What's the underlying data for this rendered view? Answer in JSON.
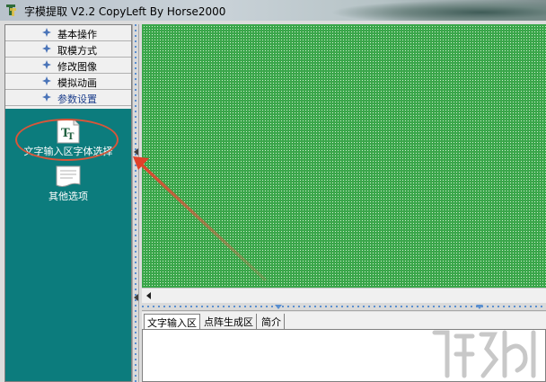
{
  "window": {
    "title": "字模提取 V2.2  CopyLeft By Horse2000",
    "icon": "app-icon"
  },
  "menu": {
    "items": [
      {
        "label": "基本操作",
        "icon": "diamond-icon"
      },
      {
        "label": "取模方式",
        "icon": "diamond-icon"
      },
      {
        "label": "修改图像",
        "icon": "diamond-icon"
      },
      {
        "label": "模拟动画",
        "icon": "diamond-icon"
      },
      {
        "label": "参数设置",
        "icon": "diamond-icon"
      }
    ]
  },
  "tools": [
    {
      "label": "文字输入区字体选择",
      "icon": "font-tt-icon"
    },
    {
      "label": "其他选项",
      "icon": "document-icon"
    }
  ],
  "bottom_tabs": [
    {
      "label": "文字输入区",
      "active": true
    },
    {
      "label": "点阵生成区",
      "active": false
    },
    {
      "label": "简介",
      "active": false
    }
  ],
  "colors": {
    "teal_panel": "#0c7c7d",
    "grid_green": "#3aa64a",
    "highlight_red": "#d9563a"
  }
}
